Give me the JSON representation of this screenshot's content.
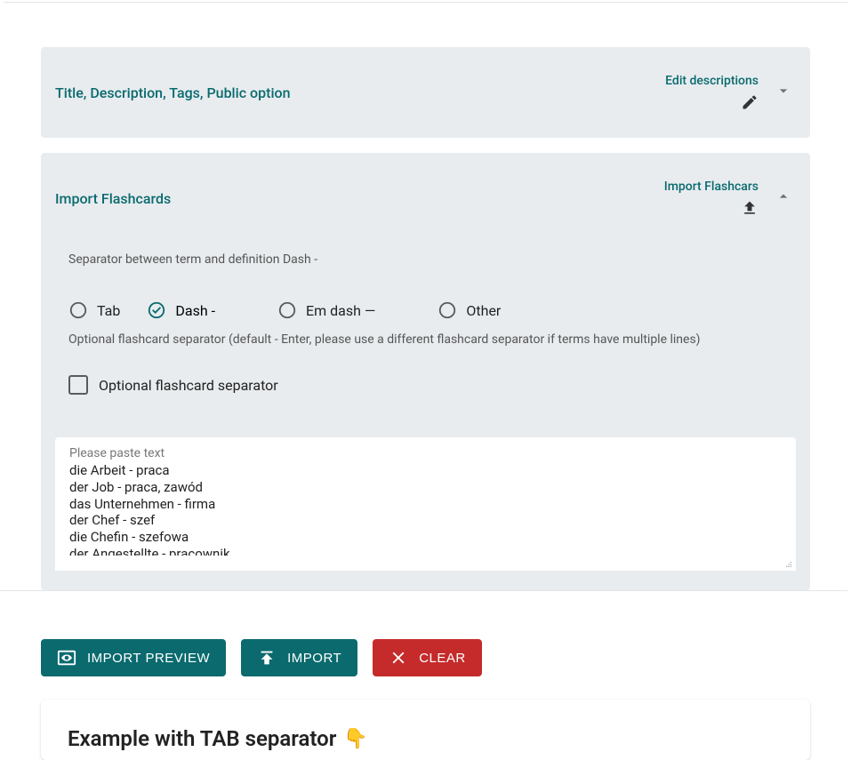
{
  "panels": {
    "title_desc": {
      "left_label": "Title, Description, Tags, Public option",
      "right_label": "Edit descriptions"
    },
    "import": {
      "left_label": "Import Flashcards",
      "right_label": "Import Flashcars"
    }
  },
  "form": {
    "separator_label": "Separator between term and definition Dash -",
    "radio": {
      "tab": "Tab",
      "dash": "Dash -",
      "emdash": "Em dash —",
      "other": "Other"
    },
    "optional_text": "Optional flashcard separator (default - Enter, please use a different flashcard separator if terms have multiple lines)",
    "checkbox_label": "Optional flashcard separator",
    "textarea_label": "Please paste text",
    "textarea_value": "die Arbeit - praca\nder Job - praca, zawód\ndas Unternehmen - firma\nder Chef - szef\ndie Chefin - szefowa\nder Angestellte - pracownik\ndie Angestellte - pracownica"
  },
  "buttons": {
    "preview": "IMPORT PREVIEW",
    "import": "IMPORT",
    "clear": "CLEAR"
  },
  "example": {
    "title": "Example with TAB separator",
    "emoji": "👇"
  }
}
